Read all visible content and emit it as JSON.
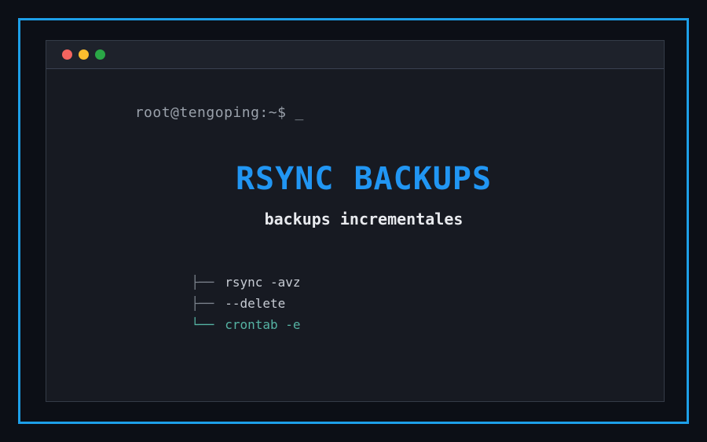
{
  "frame": {
    "border_color": "#1d9fe8"
  },
  "terminal": {
    "traffic_lights": [
      {
        "name": "close",
        "color": "#f4645f"
      },
      {
        "name": "minimize",
        "color": "#fbbd2e"
      },
      {
        "name": "maximize",
        "color": "#2aa746"
      }
    ],
    "prompt": "root@tengoping:~$",
    "cursor": "_"
  },
  "hero": {
    "title": "RSYNC BACKUPS",
    "subtitle": "backups incrementales"
  },
  "tree": {
    "items": [
      {
        "branch": "├──",
        "label": "rsync -avz",
        "highlighted": false
      },
      {
        "branch": "├──",
        "label": "--delete",
        "highlighted": false
      },
      {
        "branch": "└──",
        "label": "crontab -e",
        "highlighted": true
      }
    ]
  },
  "colors": {
    "title_blue": "#2196f3",
    "frame_blue": "#1d9fe8",
    "highlight_teal": "#55b3a3"
  }
}
